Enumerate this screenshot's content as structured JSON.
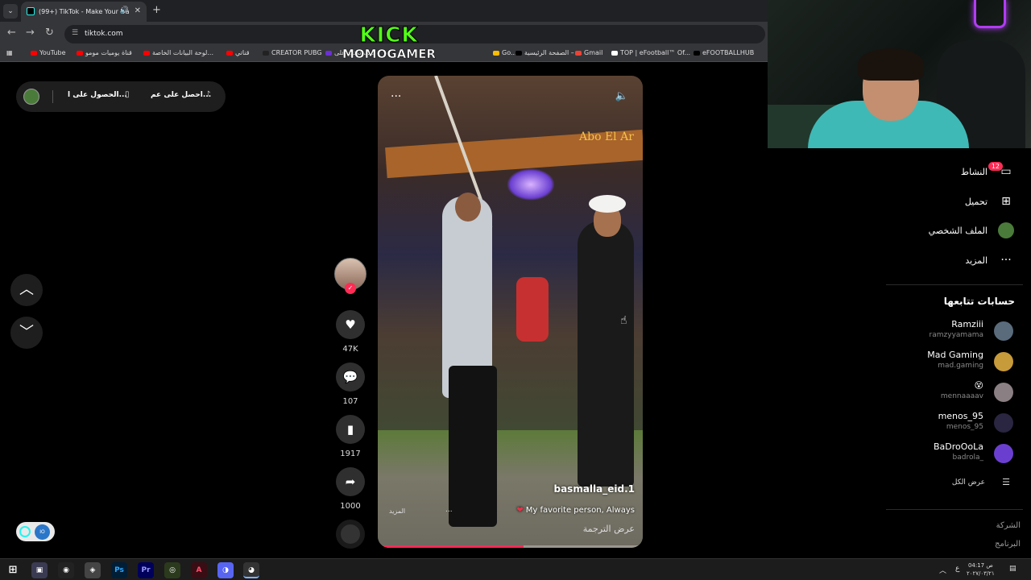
{
  "browser": {
    "tab_title": "(99+) TikTok - Make Your Da",
    "url": "tiktok.com",
    "bookmarks": [
      {
        "label": "YouTube",
        "color": "#ff0000"
      },
      {
        "label": "قناة يوميات مومو",
        "color": "#ff0000"
      },
      {
        "label": "لوحة البيانات الخاصة...",
        "color": "#ff0000"
      },
      {
        "label": "قناتي",
        "color": "#ff0000"
      },
      {
        "label": "CREATOR PUBG",
        "color": "#222222"
      },
      {
        "label": "كيف تكتب على",
        "color": "#6b2fd6"
      },
      {
        "label": "Go...",
        "color": "#fbbc05"
      },
      {
        "label": "الصفحة الرئيسية – ...",
        "color": "#000000"
      },
      {
        "label": "Gmail",
        "color": "#ea4335"
      },
      {
        "label": "TOP | eFootball™ Of...",
        "color": "#ffffff"
      },
      {
        "label": "eFOOTBALLHUB",
        "color": "#000000"
      }
    ]
  },
  "overlay": {
    "brand": "KICK",
    "channel": "MOMOGAMER",
    "brand_color": "#53fc18"
  },
  "topbar": {
    "get_app_label": "احصل على عم...",
    "get_coins_label": "الحصول على ا..."
  },
  "video": {
    "username": "basmalla_eid.1",
    "caption": "My favorite person, Always",
    "more_label": "المزيد",
    "translate_label": "عرض الترجمة",
    "progress": 0.55,
    "sign_text": "Abo El Ar"
  },
  "actions": {
    "likes": "47K",
    "comments": "107",
    "saves": "1917",
    "shares": "1000"
  },
  "sidebar": {
    "items": [
      {
        "label": "النشاط",
        "icon": "activity-icon",
        "badge": "12"
      },
      {
        "label": "تحميل",
        "icon": "upload-icon"
      },
      {
        "label": "الملف الشخصي",
        "icon": "profile-icon"
      },
      {
        "label": "المزيد",
        "icon": "more-icon"
      }
    ],
    "following_title": "حسابات تتابعها",
    "following": [
      {
        "name": "Ramziii",
        "handle": "ramzyyamama",
        "color": "#5a6b7c"
      },
      {
        "name": "Mad Gaming",
        "handle": "mad.gaming",
        "color": "#c79a3a"
      },
      {
        "name": "😵",
        "handle": "mennaaaav",
        "color": "#8a7f82"
      },
      {
        "name": "menos_95",
        "handle": "menos_95",
        "color": "#2a2540"
      },
      {
        "name": "BaDroOoLa",
        "handle": "badrola_",
        "color": "#6a3fd0"
      }
    ],
    "see_all": "عرض الكل",
    "footer": [
      "الشركة",
      "البرنامج"
    ]
  },
  "taskbar": {
    "time": "04:17 ص",
    "date": "٢٠٢٧/٠٣/٢١",
    "lang": "ع"
  }
}
